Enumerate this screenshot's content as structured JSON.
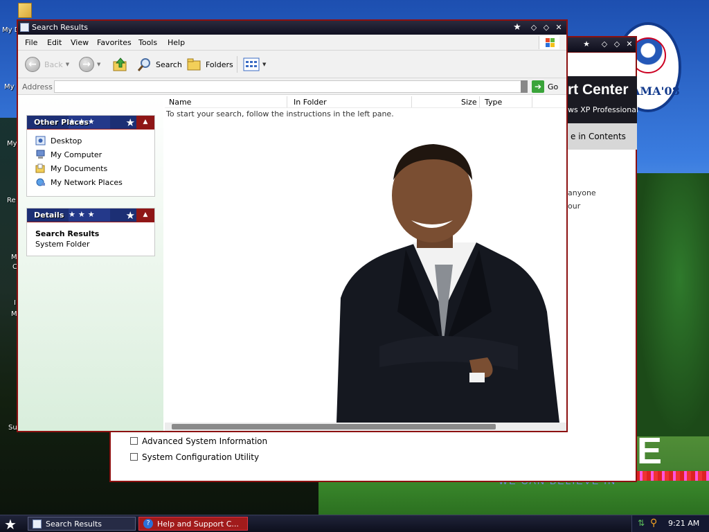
{
  "desktop": {
    "icon_labels": [
      "My D",
      "My",
      "My",
      "Re",
      "M",
      "C",
      "I",
      "M",
      "Su"
    ],
    "logo_text": "AMA'08",
    "wallpaper_letter": "E",
    "wallpaper_slogan": "WE CAN BELIEVE IN"
  },
  "help_window": {
    "title": "Help and Support Center",
    "banner_title": "rt Center",
    "banner_subtitle": "ws XP Professional",
    "toc_link": "e in Contents",
    "fragments": [
      "anyone",
      "our"
    ],
    "links": [
      "Advanced System Information",
      "System Configuration Utility"
    ]
  },
  "search_window": {
    "title": "Search Results",
    "menu": [
      "File",
      "Edit",
      "View",
      "Favorites",
      "Tools",
      "Help"
    ],
    "toolbar": {
      "back": "Back",
      "search": "Search",
      "folders": "Folders"
    },
    "address": {
      "label": "Address",
      "value": "",
      "go": "Go"
    },
    "other_places": {
      "header": "Other Places",
      "items": [
        "Desktop",
        "My Computer",
        "My Documents",
        "My Network Places"
      ]
    },
    "details": {
      "header": "Details",
      "title": "Search Results",
      "subtitle": "System Folder"
    },
    "columns": [
      "Name",
      "In Folder",
      "Size",
      "Type"
    ],
    "hint": "To start your search, follow the instructions in the left pane."
  },
  "taskbar": {
    "tasks": [
      "Search Results",
      "Help and Support C..."
    ],
    "clock": "9:21 AM"
  },
  "colors": {
    "title_bar": "#111122",
    "accent_red": "#8c1010",
    "panel_blue": "#1c2f74"
  }
}
